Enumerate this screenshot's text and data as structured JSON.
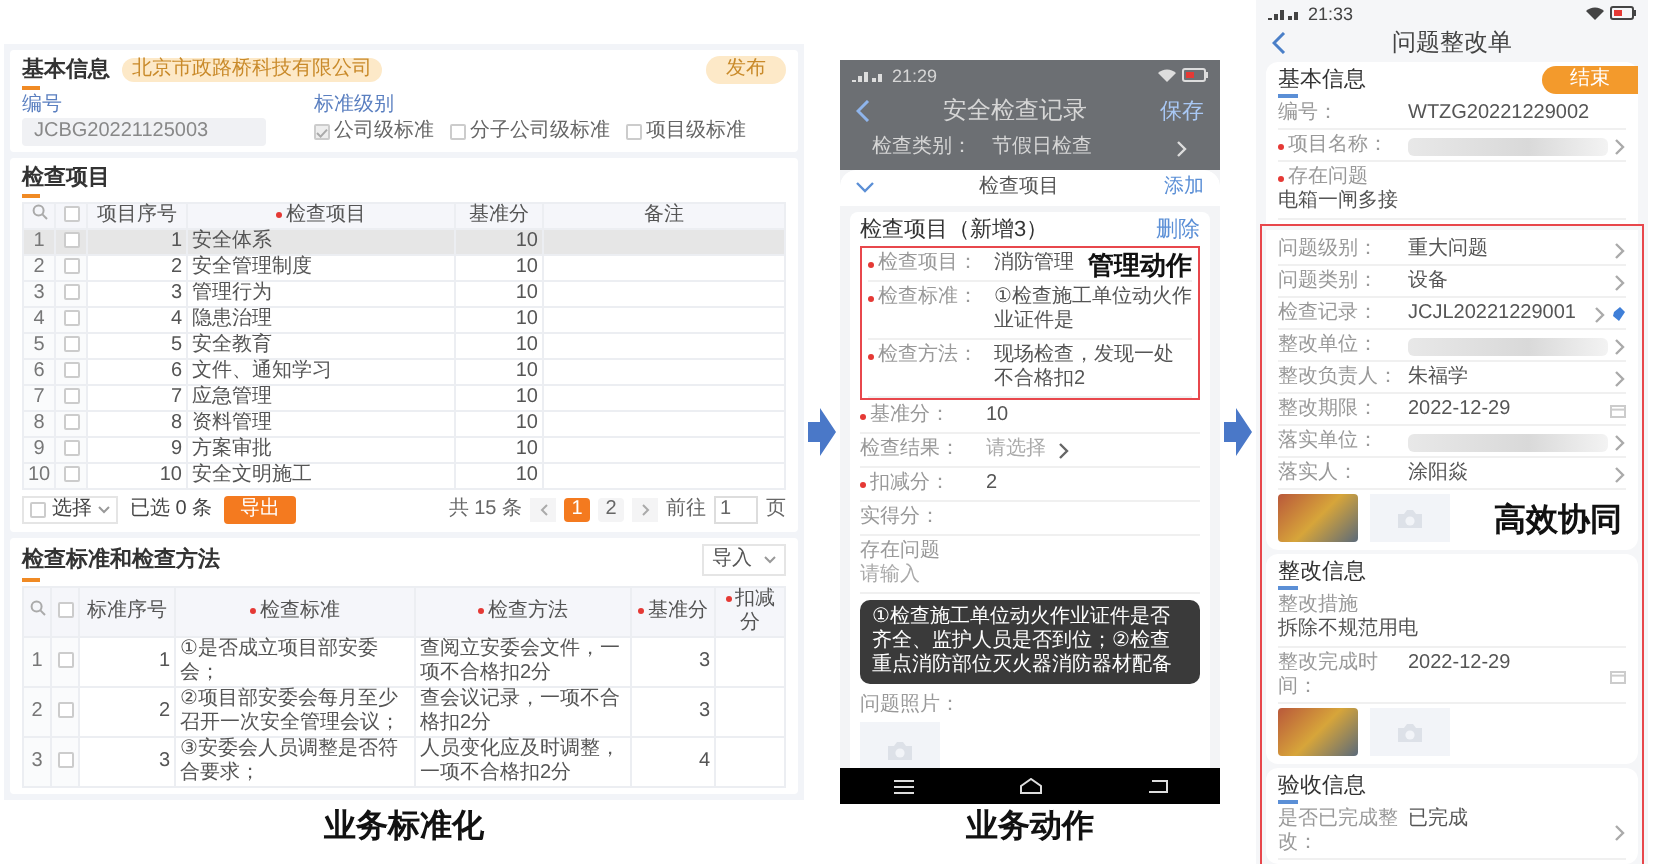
{
  "standardization": {
    "caption": "业务标准化",
    "basic_info": {
      "title": "基本信息",
      "company_badge": "北京市政路桥科技有限公司",
      "publish_button": "发布",
      "number_label": "编号",
      "number_value": "JCBG20221125003",
      "level_label": "标准级别",
      "levels": [
        {
          "label": "公司级标准",
          "checked": true
        },
        {
          "label": "分子公司级标准",
          "checked": false
        },
        {
          "label": "项目级标准",
          "checked": false
        }
      ]
    },
    "check_items": {
      "title": "检查项目",
      "header_checked": false,
      "columns": [
        {
          "label": "项目序号",
          "required": false
        },
        {
          "label": "检查项目",
          "required": true
        },
        {
          "label": "基准分",
          "required": false
        },
        {
          "label": "备注",
          "required": false
        }
      ],
      "rows": [
        {
          "index": "1",
          "no": "1",
          "name": "安全体系",
          "score": "10",
          "checked": false,
          "selected": true
        },
        {
          "index": "2",
          "no": "2",
          "name": "安全管理制度",
          "score": "10",
          "checked": false,
          "selected": false
        },
        {
          "index": "3",
          "no": "3",
          "name": "管理行为",
          "score": "10",
          "checked": false,
          "selected": false
        },
        {
          "index": "4",
          "no": "4",
          "name": "隐患治理",
          "score": "10",
          "checked": false,
          "selected": false
        },
        {
          "index": "5",
          "no": "5",
          "name": "安全教育",
          "score": "10",
          "checked": false,
          "selected": false
        },
        {
          "index": "6",
          "no": "6",
          "name": "文件、通知学习",
          "score": "10",
          "checked": false,
          "selected": false
        },
        {
          "index": "7",
          "no": "7",
          "name": "应急管理",
          "score": "10",
          "checked": false,
          "selected": false
        },
        {
          "index": "8",
          "no": "8",
          "name": "资料管理",
          "score": "10",
          "checked": false,
          "selected": false
        },
        {
          "index": "9",
          "no": "9",
          "name": "方案审批",
          "score": "10",
          "checked": false,
          "selected": false
        },
        {
          "index": "10",
          "no": "10",
          "name": "安全文明施工",
          "score": "10",
          "checked": false,
          "selected": false
        }
      ],
      "footer": {
        "select_checked": false,
        "select_label": "选择",
        "selected_count": "已选 0 条",
        "export_button": "导出",
        "total": "共 15 条",
        "pages": [
          {
            "label": "1",
            "selected": true
          },
          {
            "label": "2",
            "selected": false
          }
        ],
        "goto_label": "前往",
        "goto_value": "1",
        "page_unit": "页"
      }
    },
    "standards": {
      "title": "检查标准和检查方法",
      "import_button": "导入",
      "header_checked": false,
      "columns": [
        {
          "label": "标准序号",
          "required": false
        },
        {
          "label": "检查标准",
          "required": true
        },
        {
          "label": "检查方法",
          "required": true
        },
        {
          "label": "基准分",
          "required": true
        },
        {
          "label": "扣减分",
          "required": true
        }
      ],
      "rows": [
        {
          "index": "1",
          "no": "1",
          "standard": "①是否成立项目部安委会；",
          "method": "查阅立安委会文件，一项不合格扣2分",
          "score": "3",
          "checked": false
        },
        {
          "index": "2",
          "no": "2",
          "standard": "②项目部安委会每月至少召开一次安全管理会议；",
          "method": "查会议记录，一项不合格扣2分",
          "score": "3",
          "checked": false
        },
        {
          "index": "3",
          "no": "3",
          "standard": "③安委会人员调整是否符合要求；",
          "method": "人员变化应及时调整，一项不合格扣2分",
          "score": "4",
          "checked": false
        }
      ]
    }
  },
  "inspection_record": {
    "caption": "业务动作",
    "status_time": "21:29",
    "title": "安全检查记录",
    "save_button": "保存",
    "category_label": "检查类别：",
    "category_value": "节假日检查",
    "sheet": {
      "title": "检查项目",
      "add_button": "添加",
      "item_title": "检查项目（新增3）",
      "delete_button": "删除",
      "highlight_label": "管理动作",
      "boxed_fields": [
        {
          "label": "检查项目：",
          "value": "消防管理",
          "required": true,
          "kind": "text"
        },
        {
          "label": "检查标准：",
          "value": "①检查施工单位动火作业证件是",
          "required": true,
          "kind": "text"
        },
        {
          "label": "检查方法：",
          "value": "现场检查，发现一处不合格扣2",
          "required": true,
          "kind": "text"
        }
      ],
      "fields": [
        {
          "label": "基准分：",
          "value": "10",
          "required": true,
          "kind": "text"
        },
        {
          "label": "检查结果：",
          "placeholder": "请选择",
          "required": false,
          "kind": "select"
        },
        {
          "label": "扣减分：",
          "value": "2",
          "required": true,
          "kind": "text"
        },
        {
          "label": "实得分：",
          "required": false,
          "kind": "text"
        },
        {
          "label": "存在问题",
          "placeholder": "请输入",
          "required": false,
          "kind": "multiline"
        }
      ],
      "tooltip": "①检查施工单位动火作业证件是否齐全、监护人员是否到位；②检查重点消防部位灭火器消防器材配备",
      "photo_label": "问题照片："
    }
  },
  "rectification": {
    "status_time": "21:33",
    "title": "问题整改单",
    "highlight_label": "高效协同",
    "cards": [
      {
        "title": "基本信息",
        "end_button": "结束",
        "fields": [
          {
            "label": "编号：",
            "value": "WTZG20221229002",
            "required": false,
            "kind": "text"
          },
          {
            "label": "项目名称：",
            "required": true,
            "kind": "blurred-select"
          },
          {
            "label": "存在问题",
            "value": "电箱一闸多接",
            "required": true,
            "kind": "multiline"
          }
        ],
        "boxed_fields": [
          {
            "label": "问题级别：",
            "value": "重大问题",
            "required": false,
            "kind": "select"
          },
          {
            "label": "问题类别：",
            "value": "设备",
            "required": false,
            "kind": "select"
          },
          {
            "label": "检查记录：",
            "value": "JCJL20221229001",
            "required": false,
            "kind": "record"
          },
          {
            "label": "整改单位：",
            "required": false,
            "kind": "blurred-select"
          },
          {
            "label": "整改负责人：",
            "value": "朱福学",
            "required": false,
            "kind": "select"
          },
          {
            "label": "整改期限：",
            "value": "2022-12-29",
            "required": false,
            "kind": "date"
          },
          {
            "label": "落实单位：",
            "required": false,
            "kind": "blurred-select"
          },
          {
            "label": "落实人：",
            "value": "涂阳焱",
            "required": false,
            "kind": "select"
          }
        ],
        "photos": [
          {
            "kind": "photo"
          },
          {
            "kind": "upload"
          }
        ]
      },
      {
        "title": "整改信息",
        "boxed_fields": [
          {
            "label": "整改措施",
            "value": "拆除不规范用电",
            "required": false,
            "kind": "multiline"
          },
          {
            "label": "整改完成时间：",
            "value": "2022-12-29",
            "required": false,
            "kind": "date"
          }
        ],
        "photos": [
          {
            "kind": "photo"
          },
          {
            "kind": "upload"
          }
        ]
      },
      {
        "title": "验收信息",
        "boxed_fields": [
          {
            "label": "是否已完成整改：",
            "value": "已完成",
            "required": false,
            "kind": "select"
          }
        ]
      }
    ]
  }
}
